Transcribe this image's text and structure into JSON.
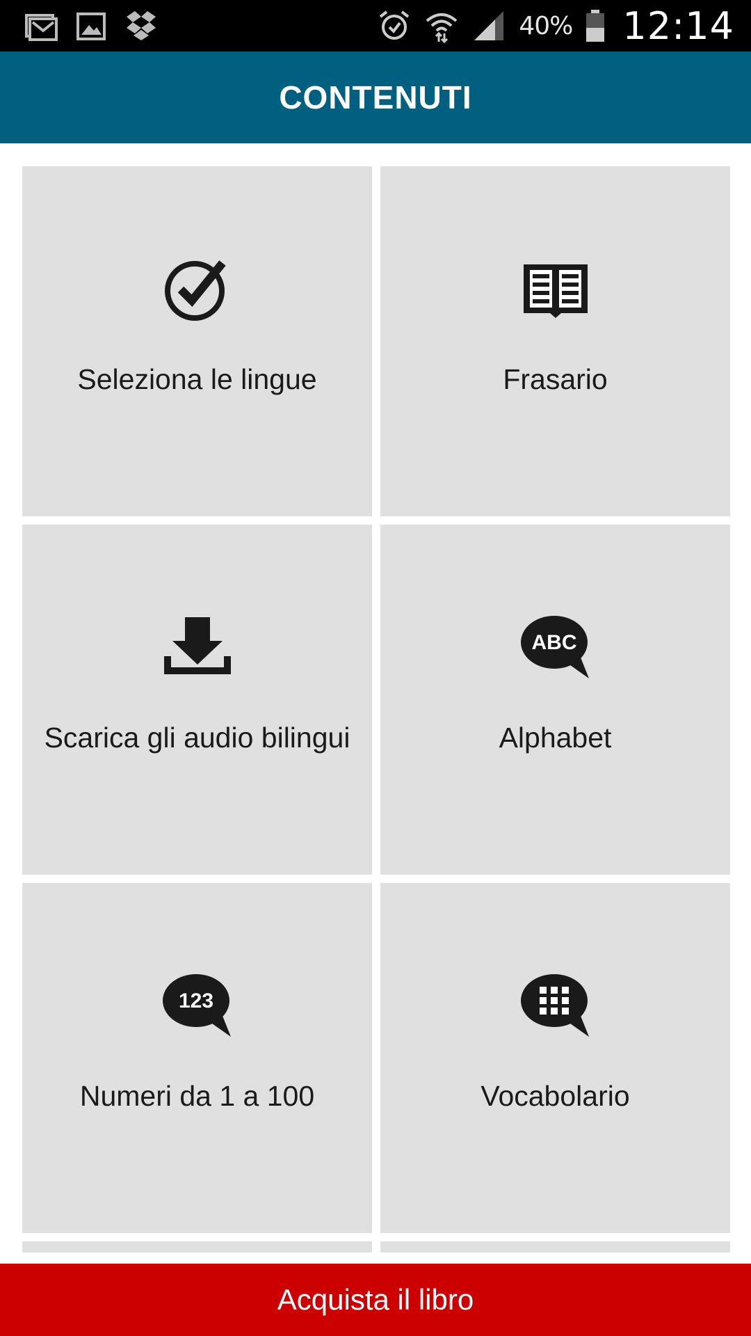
{
  "status_bar": {
    "icons_left": [
      "gmail-icon",
      "gallery-icon",
      "dropbox-icon"
    ],
    "icons_right": [
      "alarm-icon",
      "wifi-icon",
      "signal-icon",
      "battery-icon"
    ],
    "battery": "40%",
    "time": "12:14"
  },
  "header": {
    "title": "CONTENUTI"
  },
  "tiles": [
    {
      "label": "Seleziona le lingue",
      "icon": "checkmark-circle-icon"
    },
    {
      "label": "Frasario",
      "icon": "book-icon"
    },
    {
      "label": "Scarica gli audio bilingui",
      "icon": "download-icon"
    },
    {
      "label": "Alphabet",
      "icon": "abc-speech-bubble-icon",
      "icon_text": "ABC"
    },
    {
      "label": "Numeri da 1 a 100",
      "icon": "numbers-speech-bubble-icon",
      "icon_text": "123"
    },
    {
      "label": "Vocabolario",
      "icon": "grid-speech-bubble-icon"
    }
  ],
  "footer": {
    "button_label": "Acquista il libro"
  },
  "colors": {
    "status_bar": "#000000",
    "app_bar": "#015f80",
    "tile_bg": "#e0e0e0",
    "buy_button": "#cc0000"
  }
}
